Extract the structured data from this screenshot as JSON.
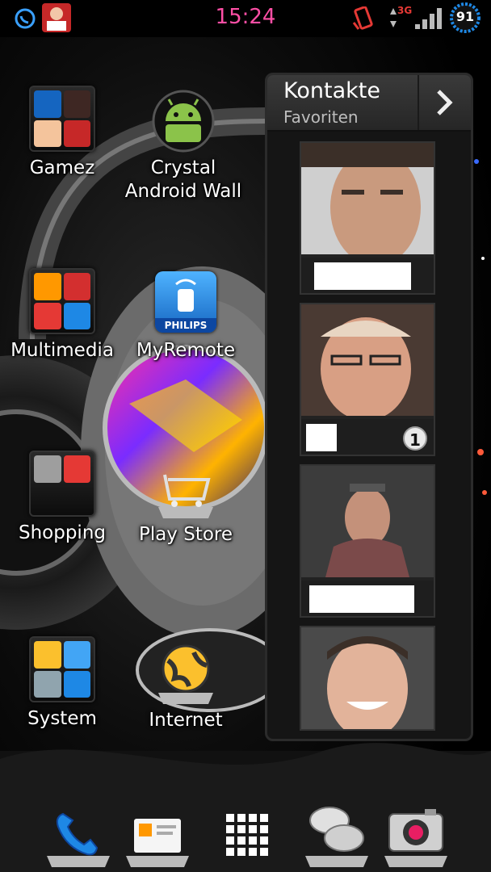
{
  "status_bar": {
    "time": "15:24",
    "network": "3G",
    "battery": "91",
    "icons": [
      "whatsapp-icon",
      "game-avatar-icon",
      "rotation-icon",
      "data-arrows-icon",
      "signal-icon",
      "battery-icon"
    ]
  },
  "apps": [
    {
      "id": "gamez",
      "label": "Gamez",
      "type": "folder"
    },
    {
      "id": "crystal",
      "label_line1": "Crystal",
      "label_line2": "Android Wall",
      "type": "app"
    },
    {
      "id": "multimedia",
      "label": "Multimedia",
      "type": "folder"
    },
    {
      "id": "myremote",
      "label": "MyRemote",
      "type": "app",
      "brand": "PHILIPS"
    },
    {
      "id": "shopping",
      "label": "Shopping",
      "type": "folder"
    },
    {
      "id": "playstore",
      "label": "Play Store",
      "type": "app"
    },
    {
      "id": "system",
      "label": "System",
      "type": "folder"
    },
    {
      "id": "internet",
      "label": "Internet",
      "type": "app"
    }
  ],
  "contacts_widget": {
    "title": "Kontakte",
    "subtitle": "Favoriten",
    "cards": [
      {
        "badge": ""
      },
      {
        "badge": "1"
      },
      {
        "badge": ""
      },
      {
        "badge": ""
      }
    ]
  },
  "dock": [
    "phone-icon",
    "contacts-card-icon",
    "app-drawer-icon",
    "messages-icon",
    "camera-icon"
  ],
  "colors": {
    "clock": "#ff4fa6",
    "widget_bg": "#151515",
    "accent_blue": "#1e88e5"
  }
}
